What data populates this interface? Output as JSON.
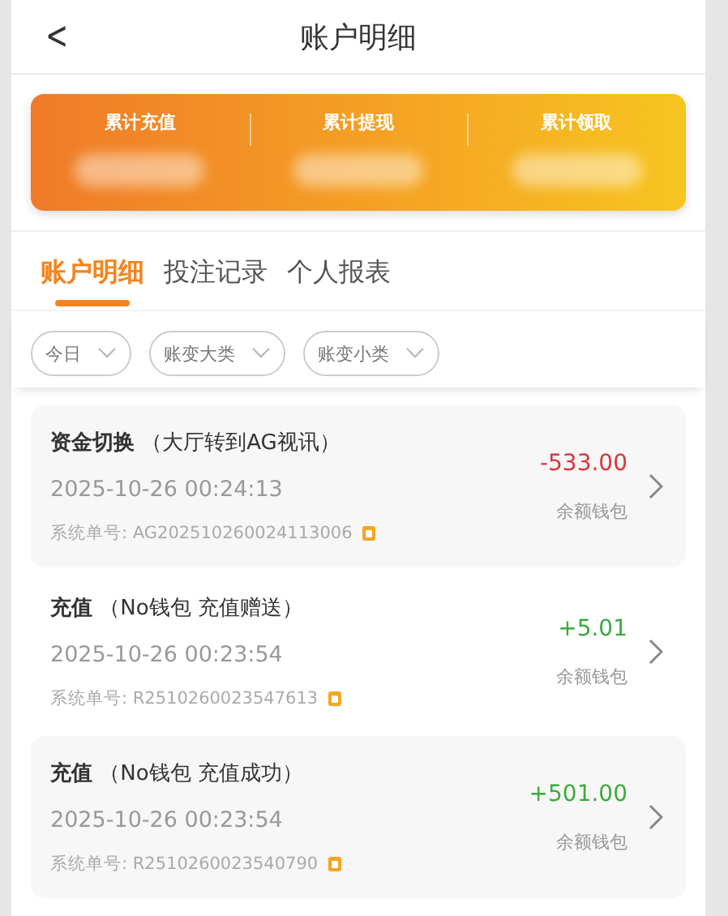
{
  "header": {
    "back": "<",
    "title": "账户明细"
  },
  "summary": [
    {
      "label": "累计充值"
    },
    {
      "label": "累计提现"
    },
    {
      "label": "累计领取"
    }
  ],
  "tabs": [
    {
      "label": "账户明细",
      "selected": true
    },
    {
      "label": "投注记录",
      "selected": false
    },
    {
      "label": "个人报表",
      "selected": false
    }
  ],
  "filters": [
    {
      "label": "今日"
    },
    {
      "label": "账变大类"
    },
    {
      "label": "账变小类"
    }
  ],
  "records": [
    {
      "type": "资金切换",
      "detail": "（大厅转到AG视讯）",
      "time": "2025-10-26 00:24:13",
      "order_label": "系统单号:",
      "order_no": "AG202510260024113006",
      "amount": "-533.00",
      "color": "#d9363e",
      "wallet": "余额钱包"
    },
    {
      "type": "充值",
      "detail": "（No钱包 充值赠送）",
      "time": "2025-10-26 00:23:54",
      "order_label": "系统单号:",
      "order_no": "R2510260023547613",
      "amount": "+5.01",
      "color": "#3daa3d",
      "wallet": "余额钱包"
    },
    {
      "type": "充值",
      "detail": "（No钱包 充值成功）",
      "time": "2025-10-26 00:23:54",
      "order_label": "系统单号:",
      "order_no": "R2510260023540790",
      "amount": "+501.00",
      "color": "#3daa3d",
      "wallet": "余额钱包"
    }
  ]
}
